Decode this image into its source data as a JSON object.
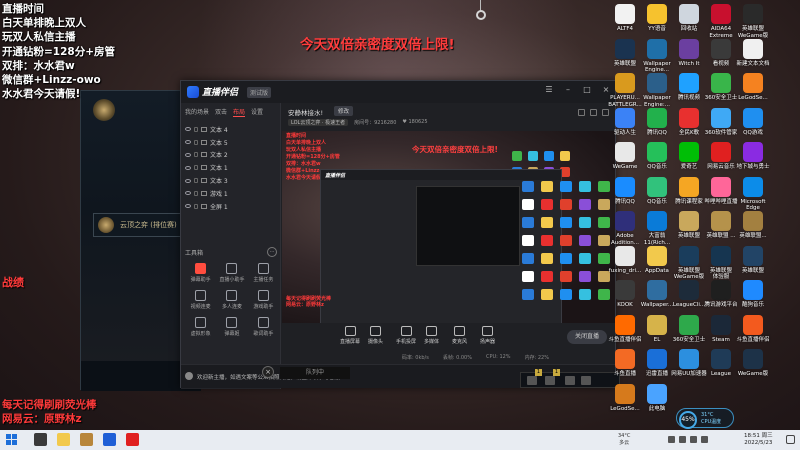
{
  "overlay": {
    "left_lines": [
      {
        "text": "直播时间",
        "color": "white"
      },
      {
        "text": "白天单排晚上双人",
        "color": "white"
      },
      {
        "text": "玩双人私信主播",
        "color": "white"
      },
      {
        "text": "开通钻粉=128分+房管",
        "color": "white"
      },
      {
        "text": "双排：水水君w",
        "color": "white"
      },
      {
        "text": "微信群+Linzz-owo",
        "color": "white"
      },
      {
        "text": "水水君今天请假!",
        "color": "white"
      }
    ],
    "center_banner": "今天双倍亲密度双倍上限!",
    "zhanji": "战绩",
    "bottom_lines": [
      "每天记得刷刷荧光棒",
      "网易云：原野林z"
    ]
  },
  "game_client": {
    "item_label": "云顶之弈 (排位赛)",
    "bottom_button": "×",
    "bottom_label": "队列中"
  },
  "app": {
    "logo": "直播伴侣",
    "version": "测试版",
    "window_controls": [
      "☰",
      "–",
      "□",
      "×"
    ],
    "scene_tabs": [
      "我的场景",
      "双击",
      "布局",
      "设置"
    ],
    "sources": [
      "文本 4",
      "文本 5",
      "文本 2",
      "文本 1",
      "文本 3",
      "游戏 1",
      "全屏 1"
    ],
    "tools_title": "工具箱",
    "tools_more": "···",
    "tools": [
      {
        "label": "弹幕助手",
        "red": true
      },
      {
        "label": "直播小助手",
        "red": false
      },
      {
        "label": "主播任务",
        "red": false
      },
      {
        "label": "视频连麦",
        "red": false
      },
      {
        "label": "多人连麦",
        "red": false
      },
      {
        "label": "游戏助手",
        "red": false
      },
      {
        "label": "虚拟形象",
        "red": false
      },
      {
        "label": "弹幕姬",
        "red": false
      },
      {
        "label": "歌词助手",
        "red": false
      }
    ],
    "room": {
      "title": "安静林接水!",
      "modify": "修改",
      "category_tag": "LOL云顶之弈 · 极速王者",
      "room_id": "房间号：9216280",
      "fans": "♥ 180625"
    },
    "preview": {
      "overlay_lines": [
        "直播时间",
        "白天单排晚上双人",
        "玩双人私信主播",
        "开通钻粉=128分+房管",
        "双排：水水君w",
        "微信群+Linzz-owo",
        "水水君今天请假!"
      ],
      "center": "今天双倍亲密度双倍上限!",
      "inner_logo": "直播伴侣",
      "bottom_lines": [
        "每天记得刷刷荧光棒",
        "网易云：原野林z"
      ]
    },
    "controls": [
      "直播屏幕",
      "摄像头",
      "手机投屏",
      "多媒体",
      "麦克风",
      "扬声器"
    ],
    "start_button": "关闭直播",
    "status": [
      "码率: 0kb/s",
      "丢帧: 0.00%",
      "CPU: 12%",
      "内存: 22%"
    ],
    "notice": "欢迎新主播，如遇文案等公众拍照问题，请立即联系与客服"
  },
  "desktop": {
    "icons": [
      {
        "label": "ALTF4",
        "color": "#f2f2f2"
      },
      {
        "label": "YY语音",
        "color": "#f6c22e"
      },
      {
        "label": "回收站",
        "color": "#cfd6de"
      },
      {
        "label": "AIDA64\nExtreme",
        "color": "#c8102e"
      },
      {
        "label": "英雄联盟\nWeGame版",
        "color": "#2a2a2a"
      },
      {
        "label": "英雄联盟",
        "color": "#1a3350"
      },
      {
        "label": "Wallpaper\nEngine...",
        "color": "#1f6fa8"
      },
      {
        "label": "Witch It",
        "color": "#6b3fa0"
      },
      {
        "label": "看视频",
        "color": "#3a3a3a"
      },
      {
        "label": "新建文本文档",
        "color": "#f0f0f0"
      },
      {
        "label": "PLAYERU...\nBATTLEGR...",
        "color": "#d99a1e"
      },
      {
        "label": "Wallpaper\nEngine:...",
        "color": "#2b5f8a"
      },
      {
        "label": "腾讯视频",
        "color": "#1fa1ff"
      },
      {
        "label": "360安全卫士",
        "color": "#39b54a"
      },
      {
        "label": "LeGodSe...",
        "color": "#f58220"
      },
      {
        "label": "驱动人生",
        "color": "#3b82f6"
      },
      {
        "label": "腾讯QQ",
        "color": "#22b14c"
      },
      {
        "label": "全民K歌",
        "color": "#e8302f"
      },
      {
        "label": "360软件管家",
        "color": "#3fa9f5"
      },
      {
        "label": "QQ游戏",
        "color": "#1f8ff0"
      },
      {
        "label": "WeGame",
        "color": "#e8e8e8"
      },
      {
        "label": "QQ音乐",
        "color": "#25c05a"
      },
      {
        "label": "爱奇艺",
        "color": "#00be06"
      },
      {
        "label": "网易云音乐",
        "color": "#e02020"
      },
      {
        "label": "地下城与勇士",
        "color": "#8a2be2"
      },
      {
        "label": "腾讯QQ",
        "color": "#1a8cff"
      },
      {
        "label": "QQ音乐",
        "color": "#31c27c"
      },
      {
        "label": "腾讯课程家",
        "color": "#f5a623"
      },
      {
        "label": "哔哩哔哩直播",
        "color": "#ff6699"
      },
      {
        "label": "Microsoft\nEdge",
        "color": "#0c8ce9"
      },
      {
        "label": "Adobe\nAudition...",
        "color": "#2f2f7a"
      },
      {
        "label": "大富翁\n11(Rich...",
        "color": "#0a7bd8"
      },
      {
        "label": "英雄联盟",
        "color": "#c9a85c"
      },
      {
        "label": "英雄联盟 ...",
        "color": "#b5924b"
      },
      {
        "label": "英雄联盟...",
        "color": "#a38040"
      },
      {
        "label": "fuxing_dri...",
        "color": "#e8e8e8"
      },
      {
        "label": "AppData",
        "color": "#f2c94c"
      },
      {
        "label": "英雄联盟\nWeGame版",
        "color": "#1a3d5c"
      },
      {
        "label": "英雄联盟\n体验服",
        "color": "#163550"
      },
      {
        "label": "英雄联盟",
        "color": "#224466"
      },
      {
        "label": "KOOK",
        "color": "#3a3a3a"
      },
      {
        "label": "Wallpaper...",
        "color": "#2f6da0"
      },
      {
        "label": "LeagueCli...",
        "color": "#1d2b3a"
      },
      {
        "label": "腾讯游戏平台",
        "color": "#1f1f1f"
      },
      {
        "label": "酷狗音乐",
        "color": "#1f8aff"
      },
      {
        "label": "斗鱼直播伴侣",
        "color": "#ff6a00"
      },
      {
        "label": "EL",
        "color": "#d6b34a"
      },
      {
        "label": "360安全卫士",
        "color": "#2ea94b"
      },
      {
        "label": "Steam",
        "color": "#1b2838"
      },
      {
        "label": "斗鱼直播伴侣",
        "color": "#f35a1e"
      },
      {
        "label": "斗鱼直播",
        "color": "#f36a24"
      },
      {
        "label": "迅雷直播",
        "color": "#1a6fd8"
      },
      {
        "label": "网易UU加速器",
        "color": "#2c8fdf"
      },
      {
        "label": "League",
        "color": "#1f3b57"
      },
      {
        "label": "WeGame版",
        "color": "#1d3248"
      },
      {
        "label": "LeGodSe...",
        "color": "#d67a1c"
      },
      {
        "label": "此电脑",
        "color": "#4aa3ff"
      }
    ]
  },
  "cpu_widget": {
    "percent": "45%",
    "line1": "31°C",
    "line2": "CPU温度"
  },
  "taskbar": {
    "weather_temp": "34°C",
    "weather_desc": "多云",
    "time": "18:51 周三",
    "date": "2022/5/23"
  },
  "colors": {
    "accent_red": "#ff3a3a",
    "app_bg": "#1f2024",
    "taskbar": "#e8ecf2"
  }
}
